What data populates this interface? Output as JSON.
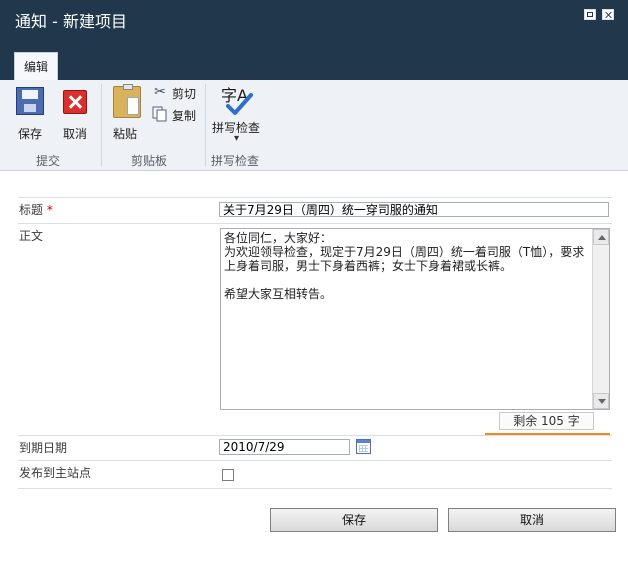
{
  "window": {
    "title": "通知 - 新建项目"
  },
  "ribbon": {
    "active_tab": "编辑",
    "groups": [
      {
        "label": "提交"
      },
      {
        "label": "剪贴板"
      },
      {
        "label": "拼写检查"
      }
    ],
    "buttons": {
      "save": "保存",
      "cancel": "取消",
      "paste": "粘贴",
      "cut": "剪切",
      "copy": "复制",
      "spell": "拼写检查",
      "spell_icon_text": "字A"
    }
  },
  "form": {
    "title_label": "标题",
    "required_mark": "*",
    "title_value": "关于7月29日（周四）统一穿司服的通知",
    "body_label": "正文",
    "body_value": "各位同仁，大家好：\n为欢迎领导检查，现定于7月29日（周四）统一着司服（T恤），要求上身着司服，男士下身着西裤；女士下身着裙或长裤。\n\n希望大家互相转告。",
    "remaining_text": "剩余 105 字",
    "due_label": "到期日期",
    "due_value": "2010/7/29",
    "publish_label": "发布到主站点"
  },
  "actions": {
    "save": "保存",
    "cancel": "取消"
  },
  "colors": {
    "titlebar": "#21374c",
    "accent_orange": "#f08a25",
    "required_red": "#cc0000"
  }
}
